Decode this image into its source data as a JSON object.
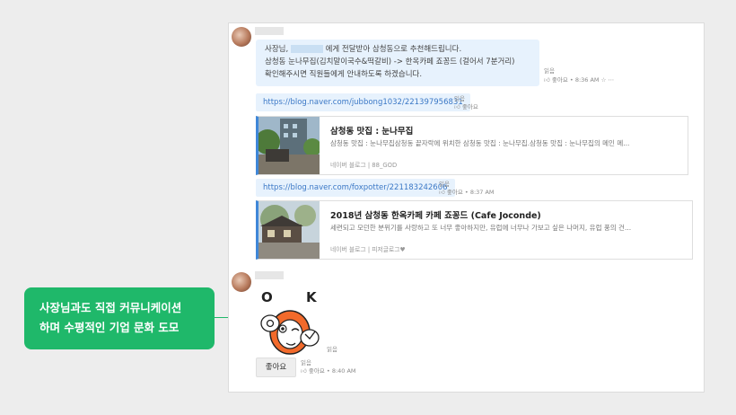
{
  "callout": {
    "line1": "사장님과도 직접 커뮤니케이션",
    "line2": "하며 수평적인 기업 문화 도모"
  },
  "message1": {
    "line1_prefix": "사장님,",
    "line1_suffix": "에게 전달받아 삼청동으로 추천해드립니다.",
    "line2": "삼청동 눈나무집(김치말이국수&떡갈비) -> 한옥카페 죠꽁드 (걸어서 7분거리)",
    "line3": "확인해주시면 직원들에게 안내하도록 하겠습니다.",
    "read": "읽음",
    "like": "좋아요",
    "time": "8:36 AM",
    "icons": [
      "thumbs-up-icon",
      "star-icon",
      "more-icon"
    ]
  },
  "link1": {
    "url": "https://blog.naver.com/jubbong1032/221397956831",
    "read": "읽음",
    "like": "좋아요",
    "card": {
      "title": "삼청동 맛집 : 눈나무집",
      "desc": "삼청동 맛집 : 눈나무집삼청동 끝자락에 위치한 삼청동 맛집 : 눈나무집.삼청동 맛집 : 눈나무집의 메인 메...",
      "source": "네이버 블로그 | 88_GOD"
    }
  },
  "link2": {
    "url": "https://blog.naver.com/foxpotter/221183242606",
    "read": "읽음",
    "like": "좋아요",
    "time": "8:37 AM",
    "card": {
      "title": "2018년 삼청동 한옥카페 카페 죠꽁드 (Cafe Joconde)",
      "desc": "세련되고 모던한 분위기를 사랑하고 또 너무 좋아하지만, 유럽에 너무나 가보고 싶은 나머지, 유럽 풍의 건...",
      "source": "네이버 블로그 | 피저글로그♥"
    }
  },
  "sticker": {
    "text": "OK",
    "read": "읽음"
  },
  "reply": {
    "button": "좋아요",
    "read": "읽음",
    "like": "좋아요",
    "time": "8:40 AM"
  },
  "colors": {
    "accent": "#1fb86a",
    "bubble": "#e7f2fd",
    "link": "#3b78c6",
    "card_border": "#3f87d8"
  }
}
